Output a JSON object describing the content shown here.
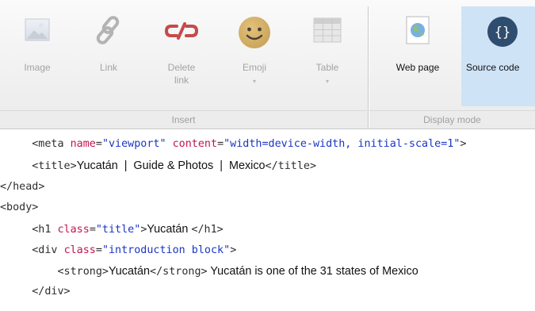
{
  "ribbon": {
    "groups": {
      "insert": "Insert",
      "display_mode": "Display mode"
    },
    "buttons": {
      "image": {
        "label": "Image",
        "icon": "image-icon"
      },
      "link": {
        "label": "Link",
        "icon": "link-icon"
      },
      "delete_link": {
        "label": "Delete link",
        "icon": "broken-link-icon"
      },
      "emoji": {
        "label": "Emoji",
        "icon": "smiley-icon",
        "dropdown": "▾"
      },
      "table": {
        "label": "Table",
        "icon": "table-icon",
        "dropdown": "▾"
      },
      "web_page": {
        "label": "Web page",
        "icon": "globe-page-icon"
      },
      "source_code": {
        "label": "Source code",
        "icon": "braces-icon"
      }
    }
  },
  "editor": {
    "lines": [
      {
        "indent": "    ",
        "parts": [
          {
            "t": "tg",
            "v": "<meta "
          },
          {
            "t": "at",
            "v": "name"
          },
          {
            "t": "tg",
            "v": "="
          },
          {
            "t": "vl",
            "v": "\"viewport\""
          },
          {
            "t": "tg",
            "v": " "
          },
          {
            "t": "at",
            "v": "content"
          },
          {
            "t": "tg",
            "v": "="
          },
          {
            "t": "vl",
            "v": "\"width=device-width, initial-scale=1\""
          },
          {
            "t": "tg",
            "v": ">"
          }
        ]
      },
      {
        "indent": "    ",
        "parts": [
          {
            "t": "tg",
            "v": "<title>"
          },
          {
            "t": "tx",
            "v": "Yucatán  |  Guide & Photos  |  Mexico"
          },
          {
            "t": "tg",
            "v": "</title>"
          }
        ]
      },
      {
        "indent": "",
        "parts": [
          {
            "t": "tg",
            "v": "</head>"
          }
        ]
      },
      {
        "indent": "",
        "parts": [
          {
            "t": "tg",
            "v": "<body>"
          }
        ]
      },
      {
        "indent": "    ",
        "parts": [
          {
            "t": "tg",
            "v": "<h1 "
          },
          {
            "t": "at",
            "v": "class"
          },
          {
            "t": "tg",
            "v": "="
          },
          {
            "t": "vl",
            "v": "\"title\""
          },
          {
            "t": "tg",
            "v": ">"
          },
          {
            "t": "tx",
            "v": "Yucatán "
          },
          {
            "t": "tg",
            "v": "</h1>"
          }
        ]
      },
      {
        "indent": "    ",
        "parts": [
          {
            "t": "tg",
            "v": "<div "
          },
          {
            "t": "at",
            "v": "class"
          },
          {
            "t": "tg",
            "v": "="
          },
          {
            "t": "vl",
            "v": "\"introduction block\""
          },
          {
            "t": "tg",
            "v": ">"
          }
        ]
      },
      {
        "indent": "        ",
        "parts": [
          {
            "t": "tg",
            "v": "<strong>"
          },
          {
            "t": "tx",
            "v": "Yucatán"
          },
          {
            "t": "tg",
            "v": "</strong>"
          },
          {
            "t": "tx",
            "v": " Yucatán is one of the 31 states of Mexico"
          }
        ]
      },
      {
        "indent": "    ",
        "parts": [
          {
            "t": "tg",
            "v": "</div>"
          }
        ]
      }
    ]
  }
}
